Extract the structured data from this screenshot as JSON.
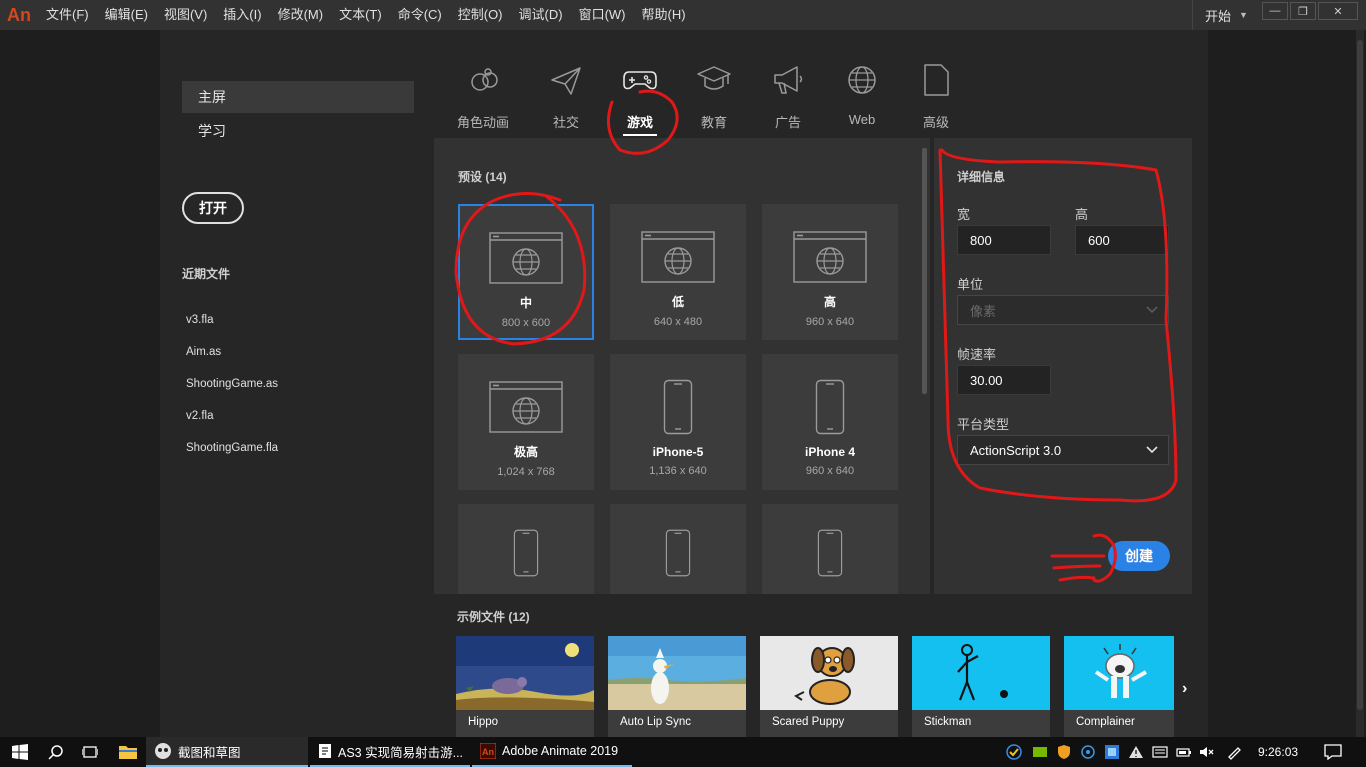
{
  "menubar": {
    "logo": "An",
    "items": [
      "文件(F)",
      "编辑(E)",
      "视图(V)",
      "插入(I)",
      "修改(M)",
      "文本(T)",
      "命令(C)",
      "控制(O)",
      "调试(D)",
      "窗口(W)",
      "帮助(H)"
    ],
    "workspace": "开始"
  },
  "nav": {
    "home": "主屏",
    "learn": "学习",
    "open": "打开",
    "recent_title": "近期文件",
    "recent_files": [
      "v3.fla",
      "Aim.as",
      "ShootingGame.as",
      "v2.fla",
      "ShootingGame.fla"
    ]
  },
  "categories": [
    {
      "label": "角色动画",
      "icon": "character-animation-icon"
    },
    {
      "label": "社交",
      "icon": "paper-plane-icon"
    },
    {
      "label": "游戏",
      "icon": "gamepad-icon",
      "active": true
    },
    {
      "label": "教育",
      "icon": "graduation-cap-icon"
    },
    {
      "label": "广告",
      "icon": "megaphone-icon"
    },
    {
      "label": "Web",
      "icon": "globe-icon"
    },
    {
      "label": "高级",
      "icon": "document-icon"
    }
  ],
  "presets": {
    "title": "预设 (14)",
    "items": [
      {
        "name": "中",
        "size": "800 x 600",
        "icon": "browser-window-icon",
        "selected": true
      },
      {
        "name": "低",
        "size": "640 x 480",
        "icon": "browser-window-icon"
      },
      {
        "name": "高",
        "size": "960 x 640",
        "icon": "browser-window-icon"
      },
      {
        "name": "极高",
        "size": "1,024 x 768",
        "icon": "browser-window-icon"
      },
      {
        "name": "iPhone-5",
        "size": "1,136 x 640",
        "icon": "phone-icon"
      },
      {
        "name": "iPhone 4",
        "size": "960 x 640",
        "icon": "phone-icon"
      },
      {
        "name": "",
        "size": "",
        "icon": "phone-icon"
      },
      {
        "name": "",
        "size": "",
        "icon": "phone-icon"
      },
      {
        "name": "",
        "size": "",
        "icon": "phone-icon"
      }
    ]
  },
  "details": {
    "title": "详细信息",
    "width_label": "宽",
    "width_value": "800",
    "height_label": "高",
    "height_value": "600",
    "units_label": "单位",
    "units_value": "像素",
    "fps_label": "帧速率",
    "fps_value": "30.00",
    "platform_label": "平台类型",
    "platform_value": "ActionScript 3.0",
    "create": "创建"
  },
  "samples": {
    "title": "示例文件 (12)",
    "items": [
      "Hippo",
      "Auto Lip Sync",
      "Scared Puppy",
      "Stickman",
      "Complainer"
    ]
  },
  "taskbar": {
    "tasks": [
      "截图和草图",
      "AS3 实现简易射击游...",
      "Adobe Animate 2019"
    ],
    "clock": "9:26:03"
  },
  "colors": {
    "accent": "#2b82e6",
    "annotation": "#e01818",
    "logo": "#d6461f"
  }
}
